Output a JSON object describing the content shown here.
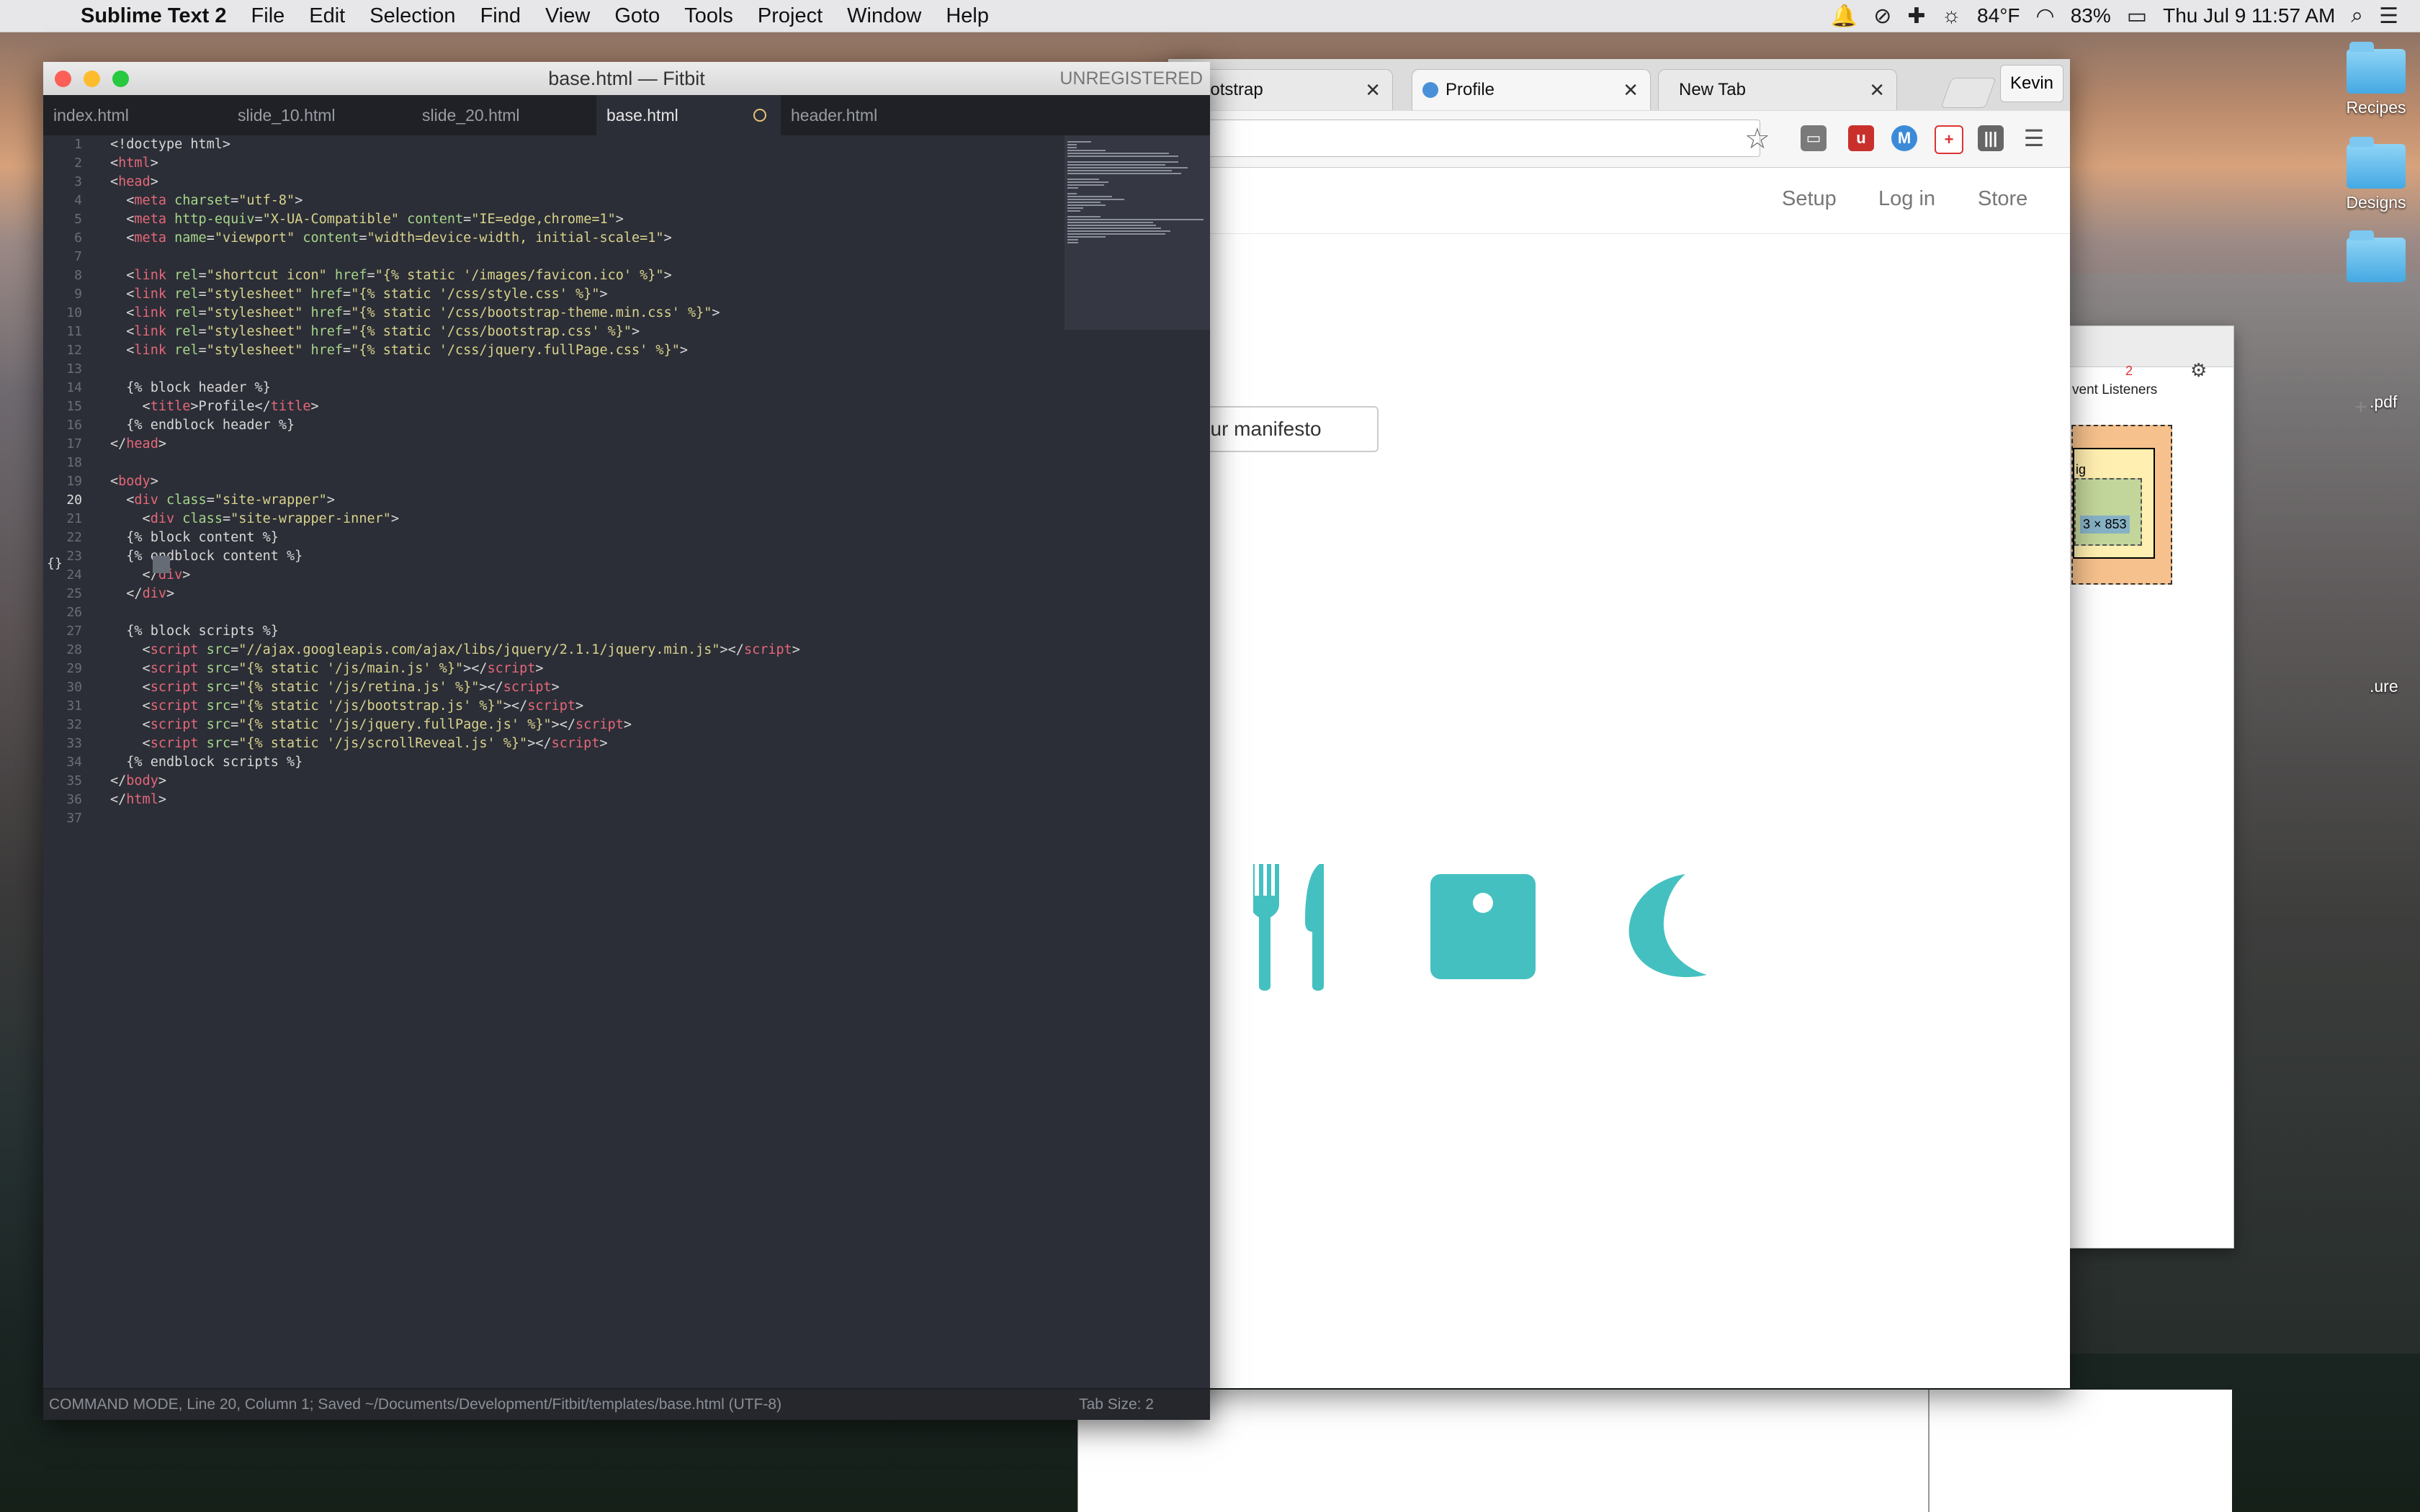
{
  "menubar": {
    "app_name": "Sublime Text 2",
    "items": [
      "File",
      "Edit",
      "Selection",
      "Find",
      "View",
      "Goto",
      "Tools",
      "Project",
      "Window",
      "Help"
    ],
    "weather": "84°F",
    "battery": "83%",
    "datetime": "Thu Jul 9  11:57 AM"
  },
  "desktop": {
    "icons": [
      {
        "label": "Recipes",
        "icon": "folder-icon"
      },
      {
        "label": "Designs",
        "icon": "folder-icon"
      },
      {
        "label": "",
        "icon": "folder-icon"
      }
    ],
    "partial_labels": [
      ".pdf",
      ".ure"
    ]
  },
  "sublime": {
    "window_title": "base.html — Fitbit",
    "unregistered": "UNREGISTERED",
    "tabs": [
      {
        "label": "index.html",
        "active": false
      },
      {
        "label": "slide_10.html",
        "active": false
      },
      {
        "label": "slide_20.html",
        "active": false
      },
      {
        "label": "base.html",
        "active": true,
        "modified": true
      },
      {
        "label": "header.html",
        "active": false
      }
    ],
    "current_line": 20,
    "lines": [
      [
        {
          "t": "pl",
          "s": "<!doctype html>"
        }
      ],
      [
        {
          "t": "pl",
          "s": "<"
        },
        {
          "t": "tg",
          "s": "html"
        },
        {
          "t": "pl",
          "s": ">"
        }
      ],
      [
        {
          "t": "pl",
          "s": "<"
        },
        {
          "t": "tg",
          "s": "head"
        },
        {
          "t": "pl",
          "s": ">"
        }
      ],
      [
        {
          "t": "pl",
          "s": "  <"
        },
        {
          "t": "tg",
          "s": "meta"
        },
        {
          "t": "pl",
          "s": " "
        },
        {
          "t": "at",
          "s": "charset"
        },
        {
          "t": "pl",
          "s": "="
        },
        {
          "t": "sv",
          "s": "\"utf-8\""
        },
        {
          "t": "pl",
          "s": ">"
        }
      ],
      [
        {
          "t": "pl",
          "s": "  <"
        },
        {
          "t": "tg",
          "s": "meta"
        },
        {
          "t": "pl",
          "s": " "
        },
        {
          "t": "at",
          "s": "http-equiv"
        },
        {
          "t": "pl",
          "s": "="
        },
        {
          "t": "sv",
          "s": "\"X-UA-Compatible\""
        },
        {
          "t": "pl",
          "s": " "
        },
        {
          "t": "at",
          "s": "content"
        },
        {
          "t": "pl",
          "s": "="
        },
        {
          "t": "sv",
          "s": "\"IE=edge,chrome=1\""
        },
        {
          "t": "pl",
          "s": ">"
        }
      ],
      [
        {
          "t": "pl",
          "s": "  <"
        },
        {
          "t": "tg",
          "s": "meta"
        },
        {
          "t": "pl",
          "s": " "
        },
        {
          "t": "at",
          "s": "name"
        },
        {
          "t": "pl",
          "s": "="
        },
        {
          "t": "sv",
          "s": "\"viewport\""
        },
        {
          "t": "pl",
          "s": " "
        },
        {
          "t": "at",
          "s": "content"
        },
        {
          "t": "pl",
          "s": "="
        },
        {
          "t": "sv",
          "s": "\"width=device-width, initial-scale=1\""
        },
        {
          "t": "pl",
          "s": ">"
        }
      ],
      [],
      [
        {
          "t": "pl",
          "s": "  <"
        },
        {
          "t": "tg",
          "s": "link"
        },
        {
          "t": "pl",
          "s": " "
        },
        {
          "t": "at",
          "s": "rel"
        },
        {
          "t": "pl",
          "s": "="
        },
        {
          "t": "sv",
          "s": "\"shortcut icon\""
        },
        {
          "t": "pl",
          "s": " "
        },
        {
          "t": "at",
          "s": "href"
        },
        {
          "t": "pl",
          "s": "="
        },
        {
          "t": "sv",
          "s": "\"{% static '/images/favicon.ico' %}\""
        },
        {
          "t": "pl",
          "s": ">"
        }
      ],
      [
        {
          "t": "pl",
          "s": "  <"
        },
        {
          "t": "tg",
          "s": "link"
        },
        {
          "t": "pl",
          "s": " "
        },
        {
          "t": "at",
          "s": "rel"
        },
        {
          "t": "pl",
          "s": "="
        },
        {
          "t": "sv",
          "s": "\"stylesheet\""
        },
        {
          "t": "pl",
          "s": " "
        },
        {
          "t": "at",
          "s": "href"
        },
        {
          "t": "pl",
          "s": "="
        },
        {
          "t": "sv",
          "s": "\"{% static '/css/style.css' %}\""
        },
        {
          "t": "pl",
          "s": ">"
        }
      ],
      [
        {
          "t": "pl",
          "s": "  <"
        },
        {
          "t": "tg",
          "s": "link"
        },
        {
          "t": "pl",
          "s": " "
        },
        {
          "t": "at",
          "s": "rel"
        },
        {
          "t": "pl",
          "s": "="
        },
        {
          "t": "sv",
          "s": "\"stylesheet\""
        },
        {
          "t": "pl",
          "s": " "
        },
        {
          "t": "at",
          "s": "href"
        },
        {
          "t": "pl",
          "s": "="
        },
        {
          "t": "sv",
          "s": "\"{% static '/css/bootstrap-theme.min.css' %}\""
        },
        {
          "t": "pl",
          "s": ">"
        }
      ],
      [
        {
          "t": "pl",
          "s": "  <"
        },
        {
          "t": "tg",
          "s": "link"
        },
        {
          "t": "pl",
          "s": " "
        },
        {
          "t": "at",
          "s": "rel"
        },
        {
          "t": "pl",
          "s": "="
        },
        {
          "t": "sv",
          "s": "\"stylesheet\""
        },
        {
          "t": "pl",
          "s": " "
        },
        {
          "t": "at",
          "s": "href"
        },
        {
          "t": "pl",
          "s": "="
        },
        {
          "t": "sv",
          "s": "\"{% static '/css/bootstrap.css' %}\""
        },
        {
          "t": "pl",
          "s": ">"
        }
      ],
      [
        {
          "t": "pl",
          "s": "  <"
        },
        {
          "t": "tg",
          "s": "link"
        },
        {
          "t": "pl",
          "s": " "
        },
        {
          "t": "at",
          "s": "rel"
        },
        {
          "t": "pl",
          "s": "="
        },
        {
          "t": "sv",
          "s": "\"stylesheet\""
        },
        {
          "t": "pl",
          "s": " "
        },
        {
          "t": "at",
          "s": "href"
        },
        {
          "t": "pl",
          "s": "="
        },
        {
          "t": "sv",
          "s": "\"{% static '/css/jquery.fullPage.css' %}\""
        },
        {
          "t": "pl",
          "s": ">"
        }
      ],
      [],
      [
        {
          "t": "pl",
          "s": "  {% block header %}"
        }
      ],
      [
        {
          "t": "pl",
          "s": "    <"
        },
        {
          "t": "tg",
          "s": "title"
        },
        {
          "t": "pl",
          "s": ">Profile</"
        },
        {
          "t": "tg",
          "s": "title"
        },
        {
          "t": "pl",
          "s": ">"
        }
      ],
      [
        {
          "t": "pl",
          "s": "  {% endblock header %}"
        }
      ],
      [
        {
          "t": "pl",
          "s": "</"
        },
        {
          "t": "tg",
          "s": "head"
        },
        {
          "t": "pl",
          "s": ">"
        }
      ],
      [],
      [
        {
          "t": "pl",
          "s": "<"
        },
        {
          "t": "tg",
          "s": "body"
        },
        {
          "t": "pl",
          "s": ">"
        }
      ],
      [
        {
          "t": "pl",
          "s": "  <"
        },
        {
          "t": "tg",
          "s": "div"
        },
        {
          "t": "pl",
          "s": " "
        },
        {
          "t": "at",
          "s": "class"
        },
        {
          "t": "pl",
          "s": "="
        },
        {
          "t": "sv",
          "s": "\"site-wrapper\""
        },
        {
          "t": "pl",
          "s": ">"
        }
      ],
      [
        {
          "t": "pl",
          "s": "    <"
        },
        {
          "t": "tg",
          "s": "div"
        },
        {
          "t": "pl",
          "s": " "
        },
        {
          "t": "at",
          "s": "class"
        },
        {
          "t": "pl",
          "s": "="
        },
        {
          "t": "sv",
          "s": "\"site-wrapper-inner\""
        },
        {
          "t": "pl",
          "s": ">"
        }
      ],
      [
        {
          "t": "pl",
          "s": "  {% block content %}"
        }
      ],
      [
        {
          "t": "pl",
          "s": "  {% endblock content %}"
        }
      ],
      [
        {
          "t": "pl",
          "s": "    </"
        },
        {
          "t": "tg",
          "s": "div"
        },
        {
          "t": "pl",
          "s": ">"
        }
      ],
      [
        {
          "t": "pl",
          "s": "  </"
        },
        {
          "t": "tg",
          "s": "div"
        },
        {
          "t": "pl",
          "s": ">"
        }
      ],
      [],
      [
        {
          "t": "pl",
          "s": "  {% block scripts %}"
        }
      ],
      [
        {
          "t": "pl",
          "s": "    <"
        },
        {
          "t": "tg",
          "s": "script"
        },
        {
          "t": "pl",
          "s": " "
        },
        {
          "t": "at",
          "s": "src"
        },
        {
          "t": "pl",
          "s": "="
        },
        {
          "t": "sv",
          "s": "\"//ajax.googleapis.com/ajax/libs/jquery/2.1.1/jquery.min.js\""
        },
        {
          "t": "pl",
          "s": "></"
        },
        {
          "t": "tg",
          "s": "script"
        },
        {
          "t": "pl",
          "s": ">"
        }
      ],
      [
        {
          "t": "pl",
          "s": "    <"
        },
        {
          "t": "tg",
          "s": "script"
        },
        {
          "t": "pl",
          "s": " "
        },
        {
          "t": "at",
          "s": "src"
        },
        {
          "t": "pl",
          "s": "="
        },
        {
          "t": "sv",
          "s": "\"{% static '/js/main.js' %}\""
        },
        {
          "t": "pl",
          "s": "></"
        },
        {
          "t": "tg",
          "s": "script"
        },
        {
          "t": "pl",
          "s": ">"
        }
      ],
      [
        {
          "t": "pl",
          "s": "    <"
        },
        {
          "t": "tg",
          "s": "script"
        },
        {
          "t": "pl",
          "s": " "
        },
        {
          "t": "at",
          "s": "src"
        },
        {
          "t": "pl",
          "s": "="
        },
        {
          "t": "sv",
          "s": "\"{% static '/js/retina.js' %}\""
        },
        {
          "t": "pl",
          "s": "></"
        },
        {
          "t": "tg",
          "s": "script"
        },
        {
          "t": "pl",
          "s": ">"
        }
      ],
      [
        {
          "t": "pl",
          "s": "    <"
        },
        {
          "t": "tg",
          "s": "script"
        },
        {
          "t": "pl",
          "s": " "
        },
        {
          "t": "at",
          "s": "src"
        },
        {
          "t": "pl",
          "s": "="
        },
        {
          "t": "sv",
          "s": "\"{% static '/js/bootstrap.js' %}\""
        },
        {
          "t": "pl",
          "s": "></"
        },
        {
          "t": "tg",
          "s": "script"
        },
        {
          "t": "pl",
          "s": ">"
        }
      ],
      [
        {
          "t": "pl",
          "s": "    <"
        },
        {
          "t": "tg",
          "s": "script"
        },
        {
          "t": "pl",
          "s": " "
        },
        {
          "t": "at",
          "s": "src"
        },
        {
          "t": "pl",
          "s": "="
        },
        {
          "t": "sv",
          "s": "\"{% static '/js/jquery.fullPage.js' %}\""
        },
        {
          "t": "pl",
          "s": "></"
        },
        {
          "t": "tg",
          "s": "script"
        },
        {
          "t": "pl",
          "s": ">"
        }
      ],
      [
        {
          "t": "pl",
          "s": "    <"
        },
        {
          "t": "tg",
          "s": "script"
        },
        {
          "t": "pl",
          "s": " "
        },
        {
          "t": "at",
          "s": "src"
        },
        {
          "t": "pl",
          "s": "="
        },
        {
          "t": "sv",
          "s": "\"{% static '/js/scrollReveal.js' %}\""
        },
        {
          "t": "pl",
          "s": "></"
        },
        {
          "t": "tg",
          "s": "script"
        },
        {
          "t": "pl",
          "s": ">"
        }
      ],
      [
        {
          "t": "pl",
          "s": "  {% endblock scripts %}"
        }
      ],
      [
        {
          "t": "pl",
          "s": "</"
        },
        {
          "t": "tg",
          "s": "body"
        },
        {
          "t": "pl",
          "s": ">"
        }
      ],
      [
        {
          "t": "pl",
          "s": "</"
        },
        {
          "t": "tg",
          "s": "html"
        },
        {
          "t": "pl",
          "s": ">"
        }
      ],
      []
    ],
    "status_left": "COMMAND MODE, Line 20, Column 1; Saved ~/Documents/Development/Fitbit/templates/base.html (UTF-8)",
    "status_right": "Tab Size: 2"
  },
  "browser": {
    "tabs": [
      {
        "label": "Bootstrap"
      },
      {
        "label": "Profile"
      },
      {
        "label": "New Tab"
      }
    ],
    "profile_button": "Kevin",
    "nav_links": [
      "Setup",
      "Log in",
      "Store"
    ],
    "manifesto_button": "ad our manifesto",
    "features": [
      {
        "icon": "fork-knife-icon"
      },
      {
        "icon": "scale-icon"
      },
      {
        "icon": "moon-icon"
      }
    ],
    "accent_color": "#45c0c0"
  },
  "devtools": {
    "event_listeners_label": "vent Listeners",
    "error_count": "2",
    "box_model_label": "ig",
    "box_model_size": "3 × 853"
  }
}
